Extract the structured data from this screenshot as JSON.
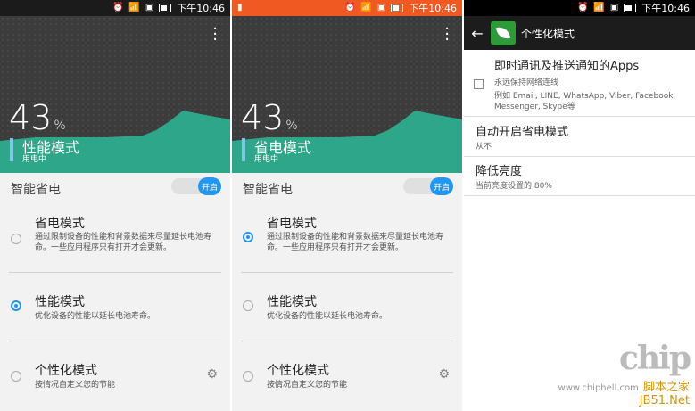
{
  "status_time": "下午10:46",
  "panel1": {
    "battery_percent": "43",
    "percent_sign": "%",
    "mode_name": "性能模式",
    "mode_sub": "用电中",
    "selected": "performance"
  },
  "panel2": {
    "battery_percent": "43",
    "percent_sign": "%",
    "mode_name": "省电模式",
    "mode_sub": "用电中",
    "selected": "power_saving"
  },
  "common": {
    "smart_saving_label": "智能省电",
    "toggle_label": "开启",
    "options": [
      {
        "title": "省电模式",
        "desc": "通过限制设备的性能和背景数据来尽量延长电池寿命。一些应用程序只有打开才会更新。"
      },
      {
        "title": "性能模式",
        "desc": "优化设备的性能以延长电池寿命。"
      },
      {
        "title": "个性化模式",
        "desc": "按情况自定义您的节能"
      }
    ]
  },
  "panel3": {
    "title": "个性化模式",
    "settings": [
      {
        "title": "即时通讯及推送通知的Apps",
        "sub": "永远保持网络连线",
        "detail": "例如 Email, LINE, WhatsApp, Viber, Facebook Messenger, Skype等"
      },
      {
        "title": "自动开启省电模式",
        "sub": "从不"
      },
      {
        "title": "降低亮度",
        "sub": "当前亮度设置的 80%"
      }
    ]
  },
  "watermark": {
    "logo": "chip",
    "url": "www.chiphell.com",
    "site": "脚本之家",
    "site2": "JB51.Net"
  },
  "colors": {
    "accent": "#2196f3",
    "graph": "#2ea68a",
    "status_orange": "#f05a22"
  }
}
